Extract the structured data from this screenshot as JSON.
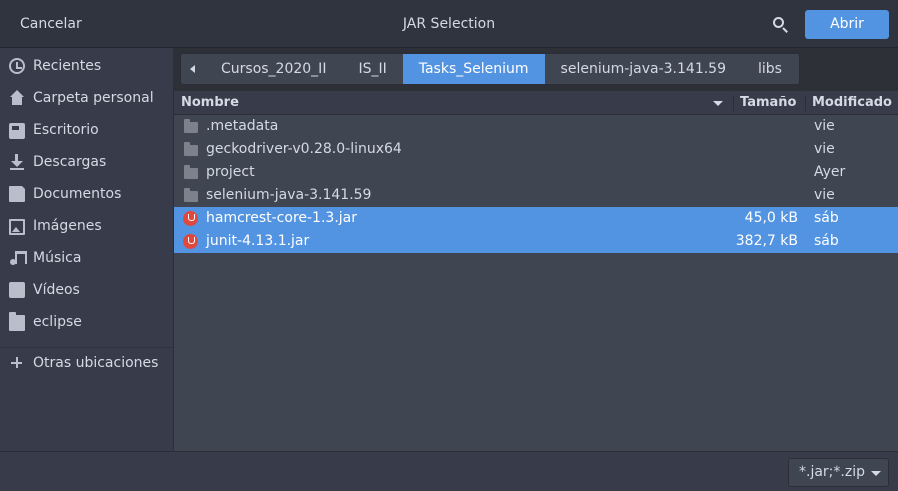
{
  "window": {
    "title": "JAR Selection",
    "cancel_label": "Cancelar",
    "open_label": "Abrir",
    "search_icon": "search-icon"
  },
  "sidebar": {
    "items": [
      {
        "label": "Recientes",
        "icon": "recent-clock-icon"
      },
      {
        "label": "Carpeta personal",
        "icon": "home-icon"
      },
      {
        "label": "Escritorio",
        "icon": "desktop-icon"
      },
      {
        "label": "Descargas",
        "icon": "download-icon"
      },
      {
        "label": "Documentos",
        "icon": "document-icon"
      },
      {
        "label": "Imágenes",
        "icon": "image-icon"
      },
      {
        "label": "Música",
        "icon": "music-icon"
      },
      {
        "label": "Vídeos",
        "icon": "video-icon"
      },
      {
        "label": "eclipse",
        "icon": "folder-icon"
      }
    ],
    "other_locations": {
      "label": "Otras ubicaciones",
      "icon": "plus-icon"
    }
  },
  "pathbar": {
    "crumbs": [
      "Cursos_2020_II",
      "IS_II",
      "Tasks_Selenium",
      "selenium-java-3.141.59",
      "libs"
    ],
    "active_index": 2
  },
  "columns": {
    "name": "Nombre",
    "size": "Tamaño",
    "modified": "Modificado"
  },
  "files": [
    {
      "name": ".metadata",
      "size": "",
      "modified": "vie",
      "type": "folder",
      "selected": false
    },
    {
      "name": "geckodriver-v0.28.0-linux64",
      "size": "",
      "modified": "vie",
      "type": "folder",
      "selected": false
    },
    {
      "name": "project",
      "size": "",
      "modified": "Ayer",
      "type": "folder",
      "selected": false
    },
    {
      "name": "selenium-java-3.141.59",
      "size": "",
      "modified": "vie",
      "type": "folder",
      "selected": false
    },
    {
      "name": "hamcrest-core-1.3.jar",
      "size": "45,0 kB",
      "modified": "sáb",
      "type": "jar",
      "selected": true
    },
    {
      "name": "junit-4.13.1.jar",
      "size": "382,7 kB",
      "modified": "sáb",
      "type": "jar",
      "selected": true
    }
  ],
  "filter": {
    "selected": "*.jar;*.zip"
  },
  "colors": {
    "accent": "#5294e2",
    "window_bg": "#404552",
    "sidebar_bg": "#383c4a",
    "jar_icon": "#e0483e"
  }
}
